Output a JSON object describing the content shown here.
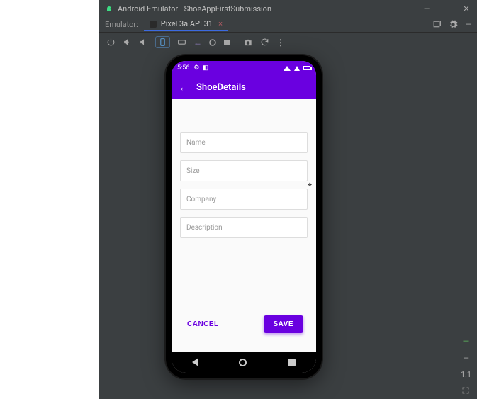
{
  "window": {
    "title": "Android Emulator - ShoeAppFirstSubmission"
  },
  "tabs": {
    "label": "Emulator:",
    "device": "Pixel 3a API 31"
  },
  "sidebar": {
    "zoom_label": "1:1"
  },
  "phone": {
    "status_time": "5:56",
    "appbar_title": "ShoeDetails",
    "fields": {
      "name": "Name",
      "size": "Size",
      "company": "Company",
      "description": "Description"
    },
    "buttons": {
      "cancel": "CANCEL",
      "save": "SAVE"
    }
  }
}
